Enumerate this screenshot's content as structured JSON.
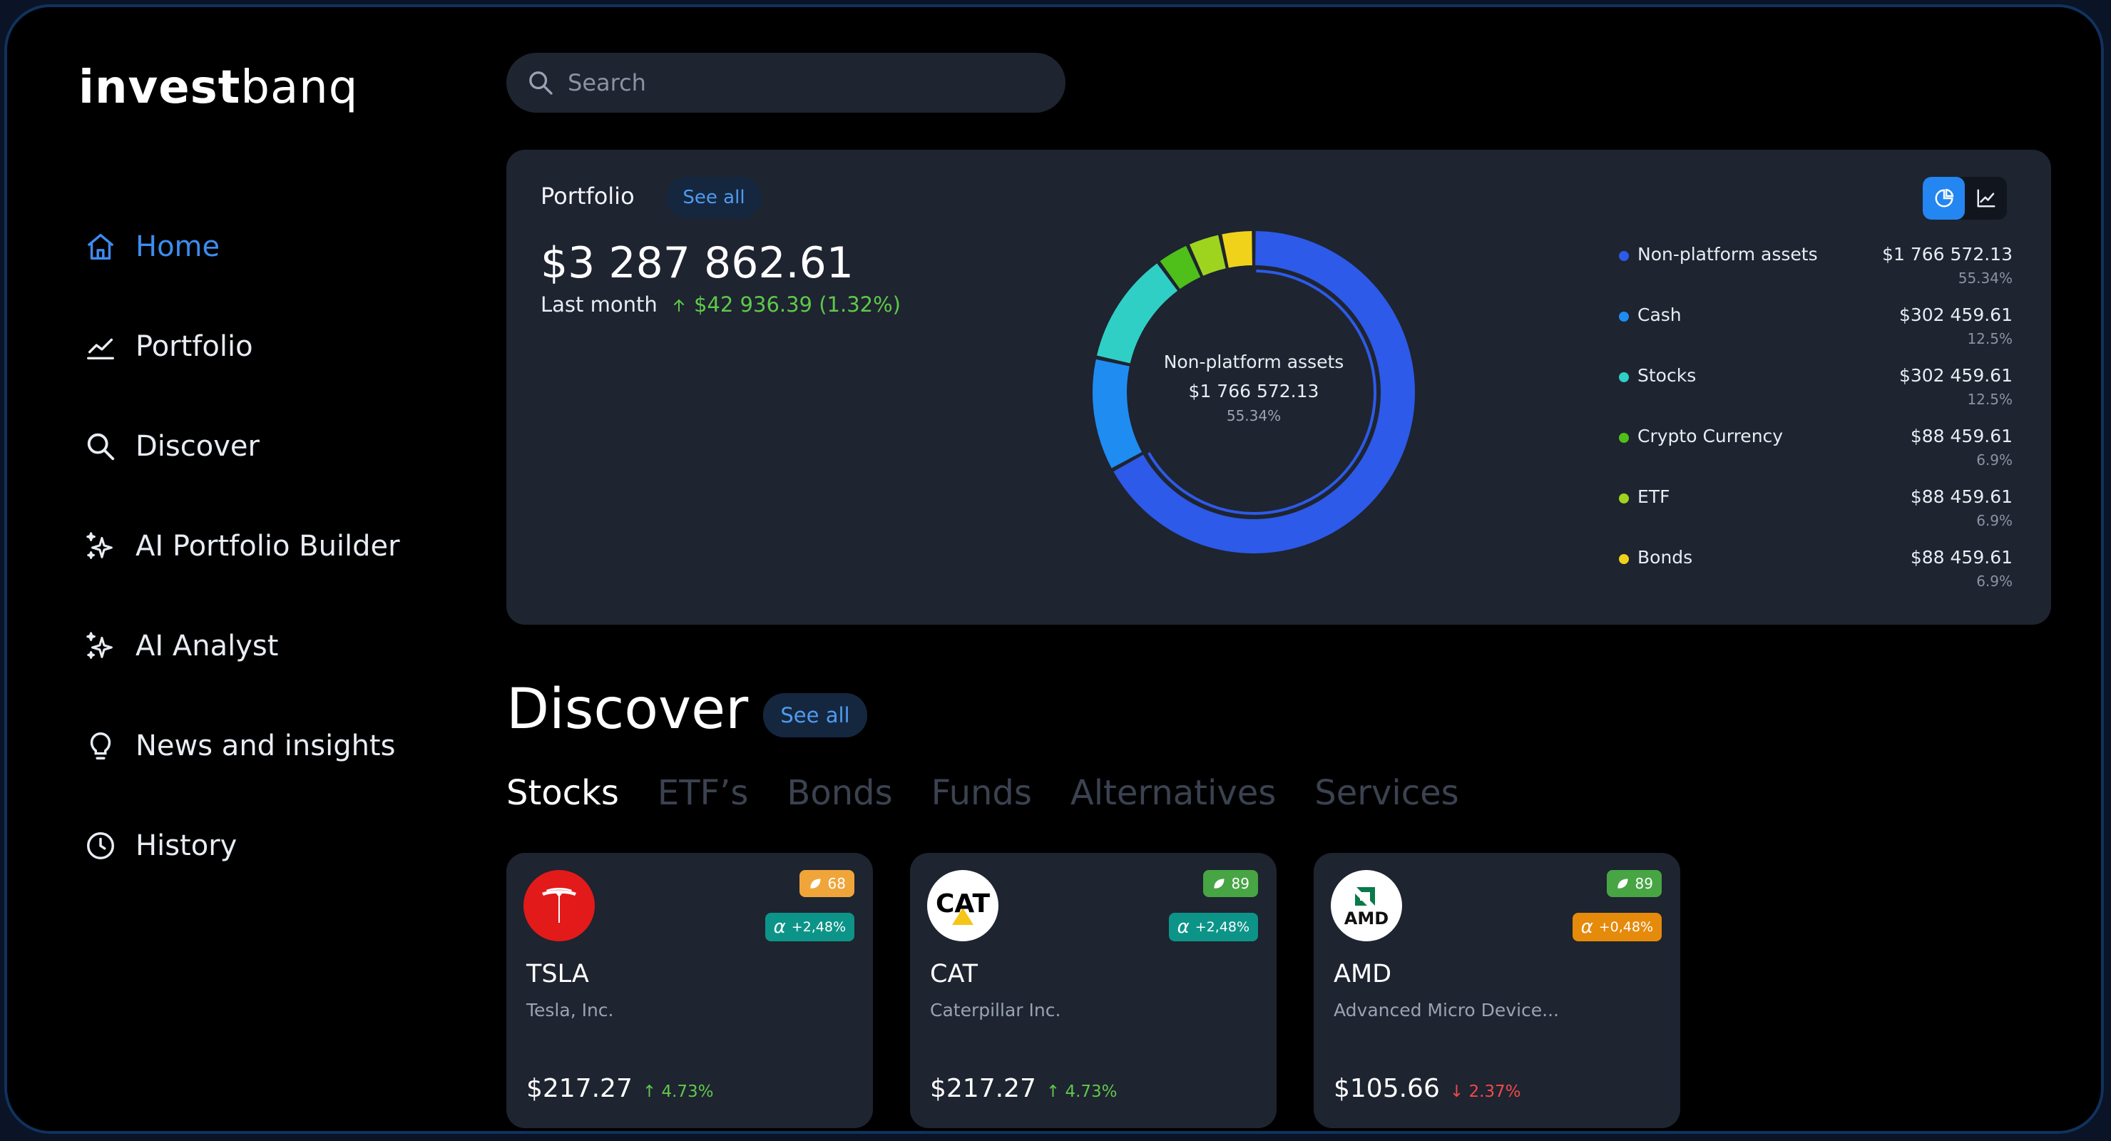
{
  "brand": {
    "bold": "invest",
    "light": "banq"
  },
  "nav": [
    {
      "label": "Home",
      "icon": "home-icon"
    },
    {
      "label": "Portfolio",
      "icon": "chart-line-icon"
    },
    {
      "label": "Discover",
      "icon": "search-icon"
    },
    {
      "label": "AI Portfolio Builder",
      "icon": "sparkle-icon"
    },
    {
      "label": "AI Analyst",
      "icon": "sparkle-icon"
    },
    {
      "label": "News and insights",
      "icon": "lightbulb-icon"
    },
    {
      "label": "History",
      "icon": "clock-icon"
    }
  ],
  "search": {
    "placeholder": "Search"
  },
  "portfolio": {
    "title": "Portfolio",
    "see_all": "See all",
    "total": "$3 287 862.61",
    "period": "Last month",
    "change": "$42 936.39 (1.32%)",
    "center": {
      "name": "Non-platform assets",
      "value": "$1 766 572.13",
      "pct": "55.34%"
    }
  },
  "colors": {
    "accent": "#2486f0",
    "non_platform": "#2d5ae8",
    "cash": "#1f8cf2",
    "stocks": "#2fcfc6",
    "crypto": "#4fc01a",
    "etf": "#9fd41e",
    "bonds": "#f0d21b",
    "up": "#5fc84a",
    "down": "#f04a4a"
  },
  "chart_data": {
    "type": "pie",
    "categories": [
      "Non-platform assets",
      "Cash",
      "Stocks",
      "Crypto Currency",
      "ETF",
      "Bonds"
    ],
    "values": [
      1766572.13,
      302459.61,
      302459.61,
      88459.61,
      88459.61,
      88459.61
    ],
    "value_labels": [
      "$1 766 572.13",
      "$302 459.61",
      "$302 459.61",
      "$88 459.61",
      "$88 459.61",
      "$88 459.61"
    ],
    "percent_labels": [
      "55.34%",
      "12.5%",
      "12.5%",
      "6.9%",
      "6.9%",
      "6.9%"
    ],
    "colors": [
      "#2d5ae8",
      "#1f8cf2",
      "#2fcfc6",
      "#4fc01a",
      "#9fd41e",
      "#f0d21b"
    ],
    "legend": "right"
  },
  "discover": {
    "title": "Discover",
    "see_all": "See all",
    "tabs": [
      "Stocks",
      "ETF’s",
      "Bonds",
      "Funds",
      "Alternatives",
      "Services"
    ],
    "cards": [
      {
        "ticker": "TSLA",
        "name": "Tesla, Inc.",
        "price": "$217.27",
        "change": "4.73%",
        "direction": "up",
        "score": "68",
        "score_color": "#f0a53a",
        "alpha": "+2,48%",
        "alpha_color": "#0d9488",
        "logo": "tesla-logo"
      },
      {
        "ticker": "CAT",
        "name": "Caterpillar Inc.",
        "price": "$217.27",
        "change": "4.73%",
        "direction": "up",
        "score": "89",
        "score_color": "#47a544",
        "alpha": "+2,48%",
        "alpha_color": "#0d9488",
        "logo": "cat-logo"
      },
      {
        "ticker": "AMD",
        "name": "Advanced Micro Device...",
        "price": "$105.66",
        "change": "2.37%",
        "direction": "down",
        "score": "89",
        "score_color": "#47a544",
        "alpha": "+0,48%",
        "alpha_color": "#e58a0a",
        "logo": "amd-logo",
        "logo_text": "AMD"
      }
    ],
    "cat_logo_text": "CAT"
  }
}
